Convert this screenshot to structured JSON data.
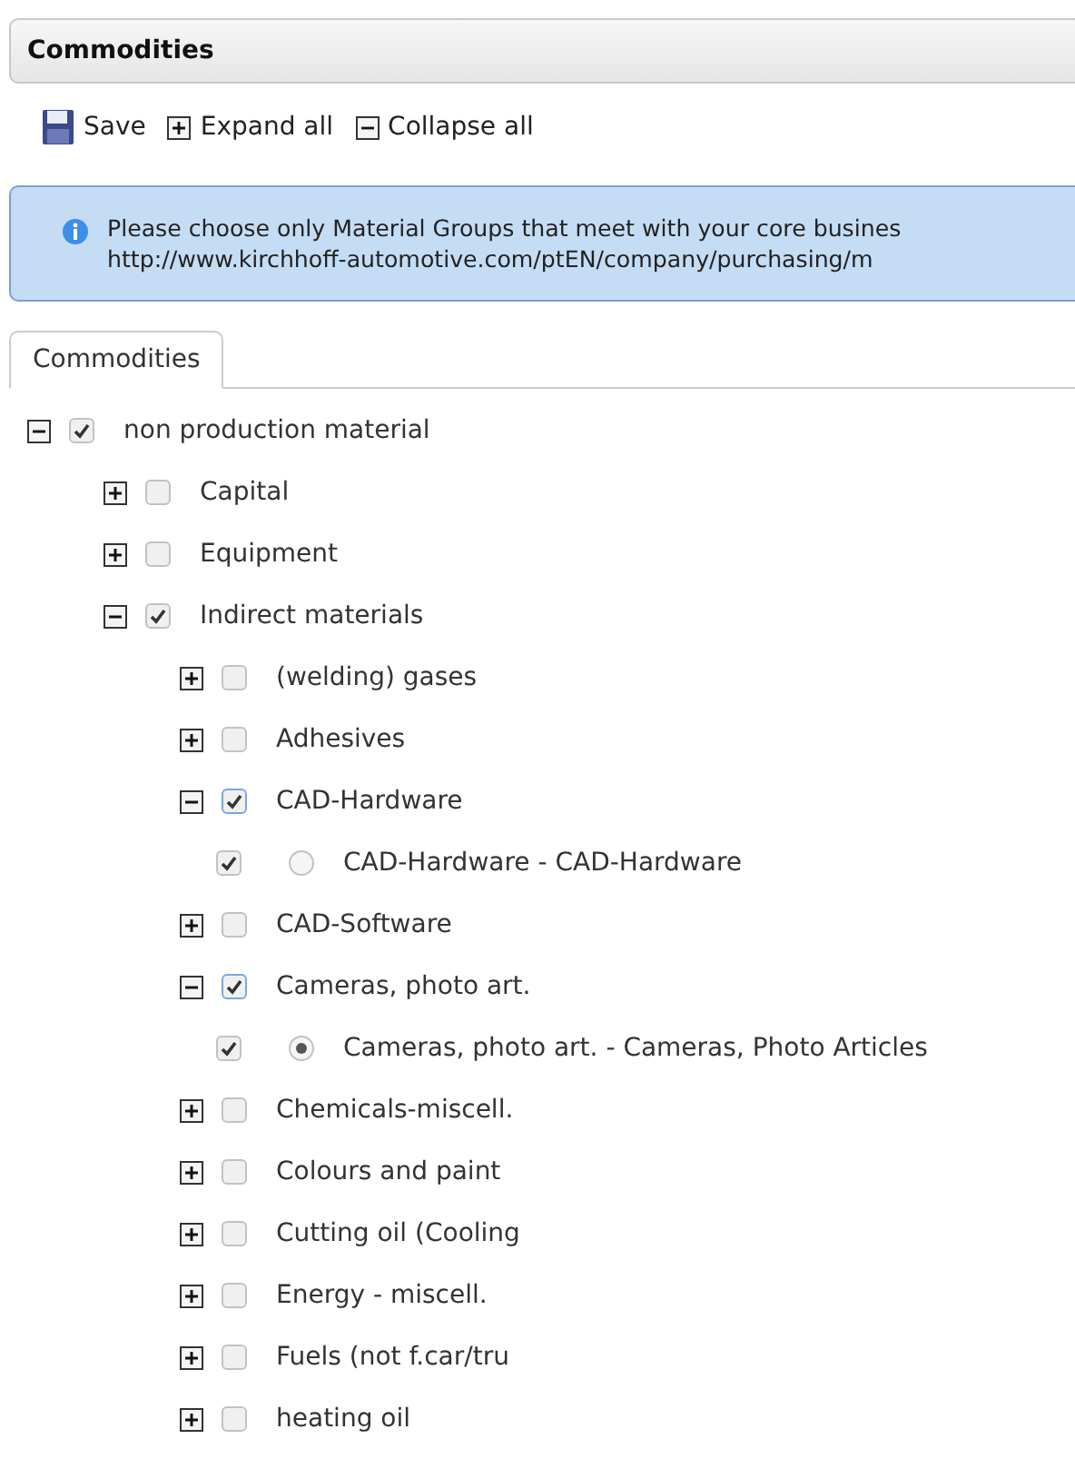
{
  "panel": {
    "title": "Commodities"
  },
  "toolbar": [
    {
      "kind": "save",
      "label": "Save"
    },
    {
      "kind": "expand",
      "label": "Expand all"
    },
    {
      "kind": "collapse",
      "label": "Collapse all"
    }
  ],
  "info": {
    "lines": [
      "Please choose only Material Groups that meet with your core busines",
      "http://www.kirchhoff-automotive.com/ptEN/company/purchasing/m"
    ]
  },
  "tabs": [
    {
      "label": "Commodities",
      "selected": true
    }
  ],
  "tree": [
    {
      "kind": "group",
      "label": "non production material",
      "checked": true,
      "expanded": true,
      "children": [
        {
          "kind": "group",
          "label": "Capital",
          "checked": false,
          "expanded": false
        },
        {
          "kind": "group",
          "label": "Equipment",
          "checked": false,
          "expanded": false
        },
        {
          "kind": "group",
          "label": "Indirect materials",
          "checked": true,
          "expanded": true,
          "children": [
            {
              "kind": "group",
              "label": "(welding) gases",
              "checked": false,
              "expanded": false
            },
            {
              "kind": "group",
              "label": "Adhesives",
              "checked": false,
              "expanded": false
            },
            {
              "kind": "group",
              "label": "CAD-Hardware",
              "checked": true,
              "expanded": true,
              "children": [
                {
                  "kind": "leaf",
                  "label": "CAD-Hardware - CAD-Hardware",
                  "checked": true,
                  "selected": false
                }
              ]
            },
            {
              "kind": "group",
              "label": "CAD-Software",
              "checked": false,
              "expanded": false
            },
            {
              "kind": "group",
              "label": "Cameras, photo art.",
              "checked": true,
              "expanded": true,
              "children": [
                {
                  "kind": "leaf",
                  "label": "Cameras, photo art. - Cameras, Photo Articles",
                  "checked": true,
                  "selected": true
                }
              ]
            },
            {
              "kind": "group",
              "label": "Chemicals-miscell.",
              "checked": false,
              "expanded": false
            },
            {
              "kind": "group",
              "label": "Colours and paint",
              "checked": false,
              "expanded": false
            },
            {
              "kind": "group",
              "label": "Cutting oil (Cooling",
              "checked": false,
              "expanded": false
            },
            {
              "kind": "group",
              "label": "Energy - miscell.",
              "checked": false,
              "expanded": false
            },
            {
              "kind": "group",
              "label": "Fuels (not f.car/tru",
              "checked": false,
              "expanded": false
            },
            {
              "kind": "group",
              "label": "heating oil",
              "checked": false,
              "expanded": false
            }
          ]
        }
      ]
    }
  ]
}
